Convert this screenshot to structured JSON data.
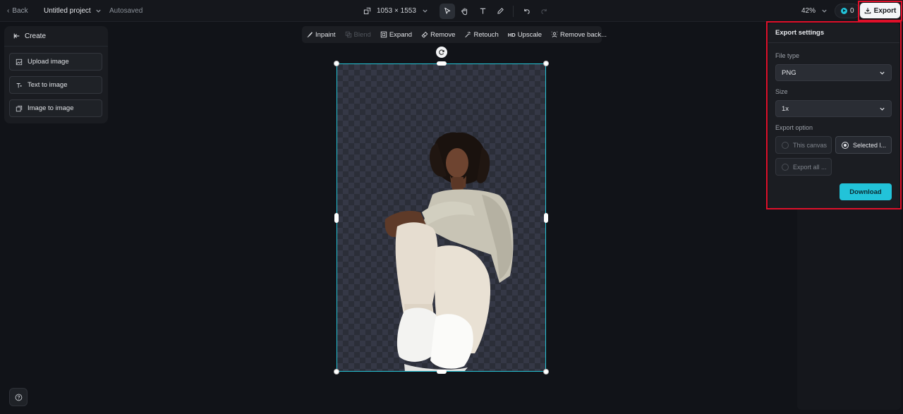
{
  "topbar": {
    "back_label": "Back",
    "project_name": "Untitled project",
    "save_status": "Autosaved",
    "canvas_size": "1053 × 1553",
    "zoom": "42%",
    "credits": "0",
    "export_label": "Export"
  },
  "create_panel": {
    "title": "Create",
    "items": [
      {
        "label": "Upload image",
        "icon": "upload-image-icon"
      },
      {
        "label": "Text to image",
        "icon": "text-to-image-icon"
      },
      {
        "label": "Image to image",
        "icon": "image-to-image-icon"
      }
    ]
  },
  "canvas_toolbar": {
    "items": [
      {
        "label": "Inpaint",
        "icon": "brush-icon",
        "disabled": false
      },
      {
        "label": "Blend",
        "icon": "blend-icon",
        "disabled": true
      },
      {
        "label": "Expand",
        "icon": "expand-icon",
        "disabled": false
      },
      {
        "label": "Remove",
        "icon": "eraser-icon",
        "disabled": false
      },
      {
        "label": "Retouch",
        "icon": "wand-icon",
        "disabled": false
      },
      {
        "label": "Upscale",
        "icon": "hd-icon",
        "disabled": false
      },
      {
        "label": "Remove back...",
        "icon": "remove-background-icon",
        "disabled": false
      }
    ]
  },
  "export_settings": {
    "title": "Export settings",
    "file_type_label": "File type",
    "file_type_value": "PNG",
    "size_label": "Size",
    "size_value": "1x",
    "export_option_label": "Export option",
    "options": [
      {
        "label": "This canvas",
        "selected": false
      },
      {
        "label": "Selected l...",
        "selected": true
      },
      {
        "label": "Export all ...",
        "selected": false
      }
    ],
    "download_label": "Download"
  },
  "colors": {
    "accent": "#22c3d9",
    "highlight": "#e0102a",
    "background": "#111318"
  }
}
